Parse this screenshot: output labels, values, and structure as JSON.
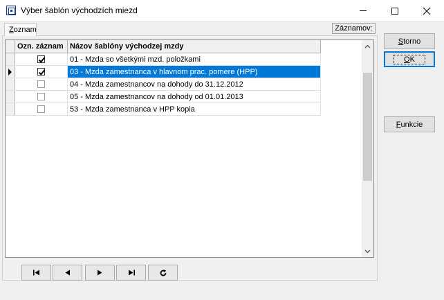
{
  "window": {
    "title": "Výber šablón východzích miezd"
  },
  "tabs": [
    {
      "label_underlined": "Z",
      "label_rest": "oznam"
    }
  ],
  "count_label": "Záznamov:",
  "grid": {
    "columns": [
      "Ozn. záznam",
      "Názov šablóny východzej mzdy"
    ],
    "rows": [
      {
        "checked": true,
        "name": "01 - Mzda so všetkými mzd. položkami",
        "selected": false
      },
      {
        "checked": true,
        "name": "03 - Mzda zamestnanca v hlavnom prac. pomere (HPP)",
        "selected": true
      },
      {
        "checked": false,
        "name": "04 - Mzda zamestnancov na dohody do 31.12.2012",
        "selected": false
      },
      {
        "checked": false,
        "name": "05 - Mzda zamestnancov na dohody od 01.01.2013",
        "selected": false
      },
      {
        "checked": false,
        "name": "53 - Mzda zamestnanca v HPP kopia",
        "selected": false
      }
    ]
  },
  "buttons": {
    "storno": {
      "underlined": "S",
      "rest": "torno"
    },
    "ok": {
      "underlined": "O",
      "rest": "K"
    },
    "funkcie": {
      "underlined": "F",
      "rest": "unkcie"
    }
  },
  "nav": {
    "first": "first-record-icon",
    "prev": "previous-record-icon",
    "next": "next-record-icon",
    "last": "last-record-icon",
    "refresh": "refresh-icon"
  },
  "colors": {
    "selection": "#0078d7",
    "window_bg": "#f0f0f0"
  }
}
